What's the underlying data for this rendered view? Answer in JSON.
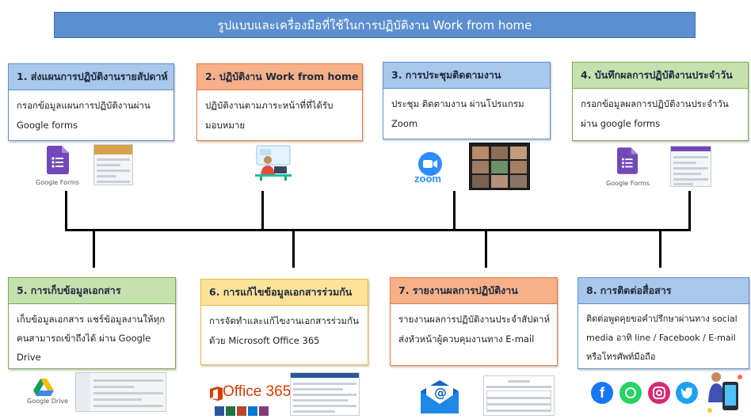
{
  "title": "รูปแบบและเครื่องมือที่ใช้ในการปฏิบัติงาน Work from home",
  "steps": [
    {
      "header": "1. ส่งแผนการปฏิบัติงานรายสัปดาห์",
      "lines": [
        "กรอกข้อมูลแผนการปฏิบัติงานผ่าน",
        "Google forms"
      ]
    },
    {
      "header": "2. ปฏิบัติงาน Work from home",
      "lines": [
        "ปฏิบัติงานตามภาระหน้าที่ที่ได้รับ",
        "มอบหมาย"
      ]
    },
    {
      "header": "3. การประชุมติดตามงาน",
      "lines": [
        "ประชุม ติดตามงาน ผ่านโปรแกรม",
        "Zoom"
      ]
    },
    {
      "header": "4. บันทึกผลการปฏิบัติงานประจำวัน",
      "lines": [
        "กรอกข้อมูลผลการปฏิบัติงานประจำวัน",
        "ผ่าน google forms"
      ]
    },
    {
      "header": "5. การเก็บข้อมูลเอกสาร",
      "lines": [
        "เก็บข้อมูลเอกสาร แชร์ข้อมูลงานให้ทุก",
        "คนสามารถเข้าถึงได้ ผ่าน Google",
        "Drive"
      ]
    },
    {
      "header": "6. การแก้ไขข้อมูลเอกสารร่วมกัน",
      "lines": [
        "การจัดทำและแก้ไขงานเอกสารร่วมกัน",
        "ด้วย Microsoft Office 365"
      ]
    },
    {
      "header": "7. รายงานผลการปฏิบัติงาน",
      "lines": [
        "รายงานผลการปฏิบัติงานประจำสัปดาห์",
        "ส่งหัวหน้าผู้ควบคุมงานทาง E-mail"
      ]
    },
    {
      "header": "8. การติดต่อสื่อสาร",
      "lines": [
        "ติดต่อพูดคุยขอคำปรึกษาผ่านทาง social",
        "media อาทิ line / Facebook / E-mail",
        "หรือโทรศัพท์มือถือ"
      ]
    }
  ],
  "logos": {
    "google_forms": "Google Forms",
    "zoom": "zoom",
    "google_drive": "Google Drive",
    "office": "Office 365",
    "email": "@"
  },
  "colors": {
    "banner": "#5b8fd0",
    "blue": "#a9c6eb",
    "orange": "#f6b089",
    "green": "#c6e1b0",
    "yellow": "#fde39a"
  }
}
